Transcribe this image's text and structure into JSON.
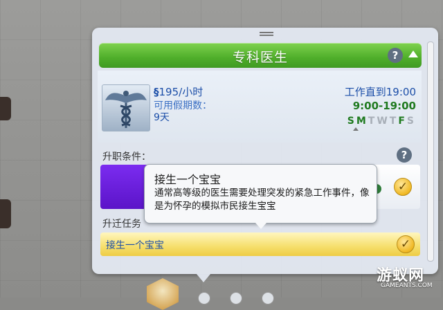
{
  "career": {
    "title": "专科医生",
    "help_glyph": "?",
    "icon": "caduceus-icon",
    "salary_symbol": "§",
    "salary_amount": "195",
    "salary_unit": "/小时",
    "vacation_label": "可用假期数：",
    "vacation_value": "9天",
    "work_until": "工作直到19:00",
    "work_hours": "9:00-19:00",
    "days": [
      {
        "letter": "S",
        "active": true
      },
      {
        "letter": "M",
        "active": true
      },
      {
        "letter": "T",
        "active": false
      },
      {
        "letter": "W",
        "active": false
      },
      {
        "letter": "T",
        "active": false
      },
      {
        "letter": "F",
        "active": true
      },
      {
        "letter": "S",
        "active": false
      }
    ]
  },
  "requirements": {
    "label": "升职条件：",
    "help_glyph": "?",
    "check_glyph": "✓"
  },
  "tasks": {
    "label": "升迁任务",
    "item": "接生一个宝宝",
    "check_glyph": "✓"
  },
  "tooltip": {
    "title": "接生一个宝宝",
    "body": "通常高等级的医生需要处理突发的紧急工作事件，像是为怀孕的模拟市民接生宝宝"
  },
  "watermark": {
    "main": "游蚁网",
    "sub": "GAMEANTS.COM"
  },
  "colors": {
    "header_green": "#4fae2a",
    "salary_blue": "#1c4ea8",
    "hours_green": "#1f7a1f",
    "task_yellow": "#f6df6c",
    "requirement_purple": "#6b1fe0"
  }
}
